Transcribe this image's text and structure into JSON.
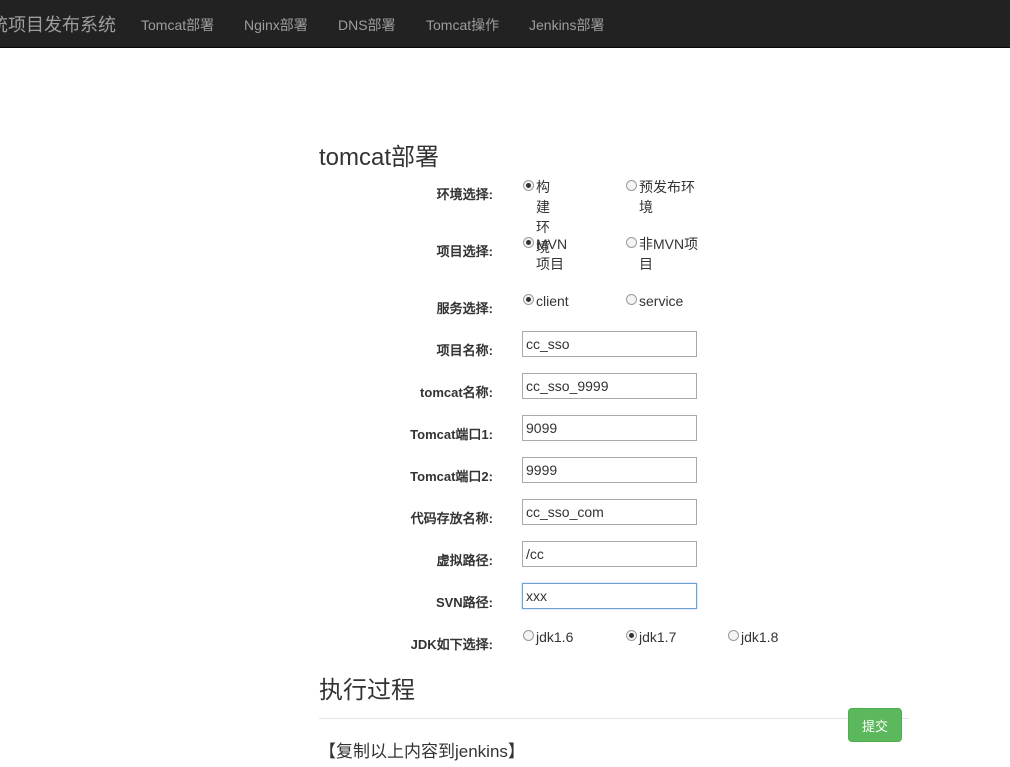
{
  "navbar": {
    "brand": "统项目发布系统",
    "links": [
      "Tomcat部署",
      "Nginx部署",
      "DNS部署",
      "Tomcat操作",
      "Jenkins部署"
    ]
  },
  "form": {
    "title": "tomcat部署",
    "environment": {
      "label": "环境选择:",
      "options": [
        "构建环境",
        "预发布环境"
      ],
      "selected": "构建环境"
    },
    "project_type": {
      "label": "项目选择:",
      "options": [
        "MVN项目",
        "非MVN项目"
      ],
      "selected": "MVN项目"
    },
    "service": {
      "label": "服务选择:",
      "options": [
        "client",
        "service"
      ],
      "selected": "client"
    },
    "project_name": {
      "label": "项目名称:",
      "value": "cc_sso"
    },
    "tomcat_name": {
      "label": "tomcat名称:",
      "value": "cc_sso_9999"
    },
    "tomcat_port1": {
      "label": "Tomcat端口1:",
      "value": "9099"
    },
    "tomcat_port2": {
      "label": "Tomcat端口2:",
      "value": "9999"
    },
    "code_storage_name": {
      "label": "代码存放名称:",
      "value": "cc_sso_com"
    },
    "virtual_path": {
      "label": "虚拟路径:",
      "value": "/cc"
    },
    "svn_path": {
      "label": "SVN路径:",
      "value": "xxx"
    },
    "jdk": {
      "label": "JDK如下选择:",
      "options": [
        "jdk1.6",
        "jdk1.7",
        "jdk1.8"
      ],
      "selected": "jdk1.7"
    }
  },
  "execution": {
    "title": "执行过程",
    "submit_label": "提交",
    "output": "【复制以上内容到jenkins】"
  },
  "colors": {
    "navbar_bg": "#222222",
    "nav_text": "#9d9d9d",
    "submit_bg": "#5cb85c",
    "focus_border": "#6f9fd8"
  }
}
